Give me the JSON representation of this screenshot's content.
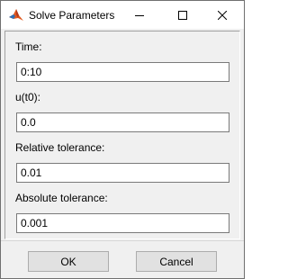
{
  "window": {
    "title": "Solve Parameters",
    "controls": {
      "minimize": "minimize-icon",
      "maximize": "maximize-icon",
      "close": "close-icon"
    }
  },
  "form": {
    "time": {
      "label": "Time:",
      "value": "0:10"
    },
    "u0": {
      "label": "u(t0):",
      "value": "0.0"
    },
    "reltol": {
      "label": "Relative tolerance:",
      "value": "0.01"
    },
    "abstol": {
      "label": "Absolute tolerance:",
      "value": "0.001"
    }
  },
  "buttons": {
    "ok": "OK",
    "cancel": "Cancel"
  },
  "colors": {
    "icon_orange": "#e0571d",
    "icon_blue": "#2d6fb5",
    "chrome": "#f0f0f0"
  }
}
